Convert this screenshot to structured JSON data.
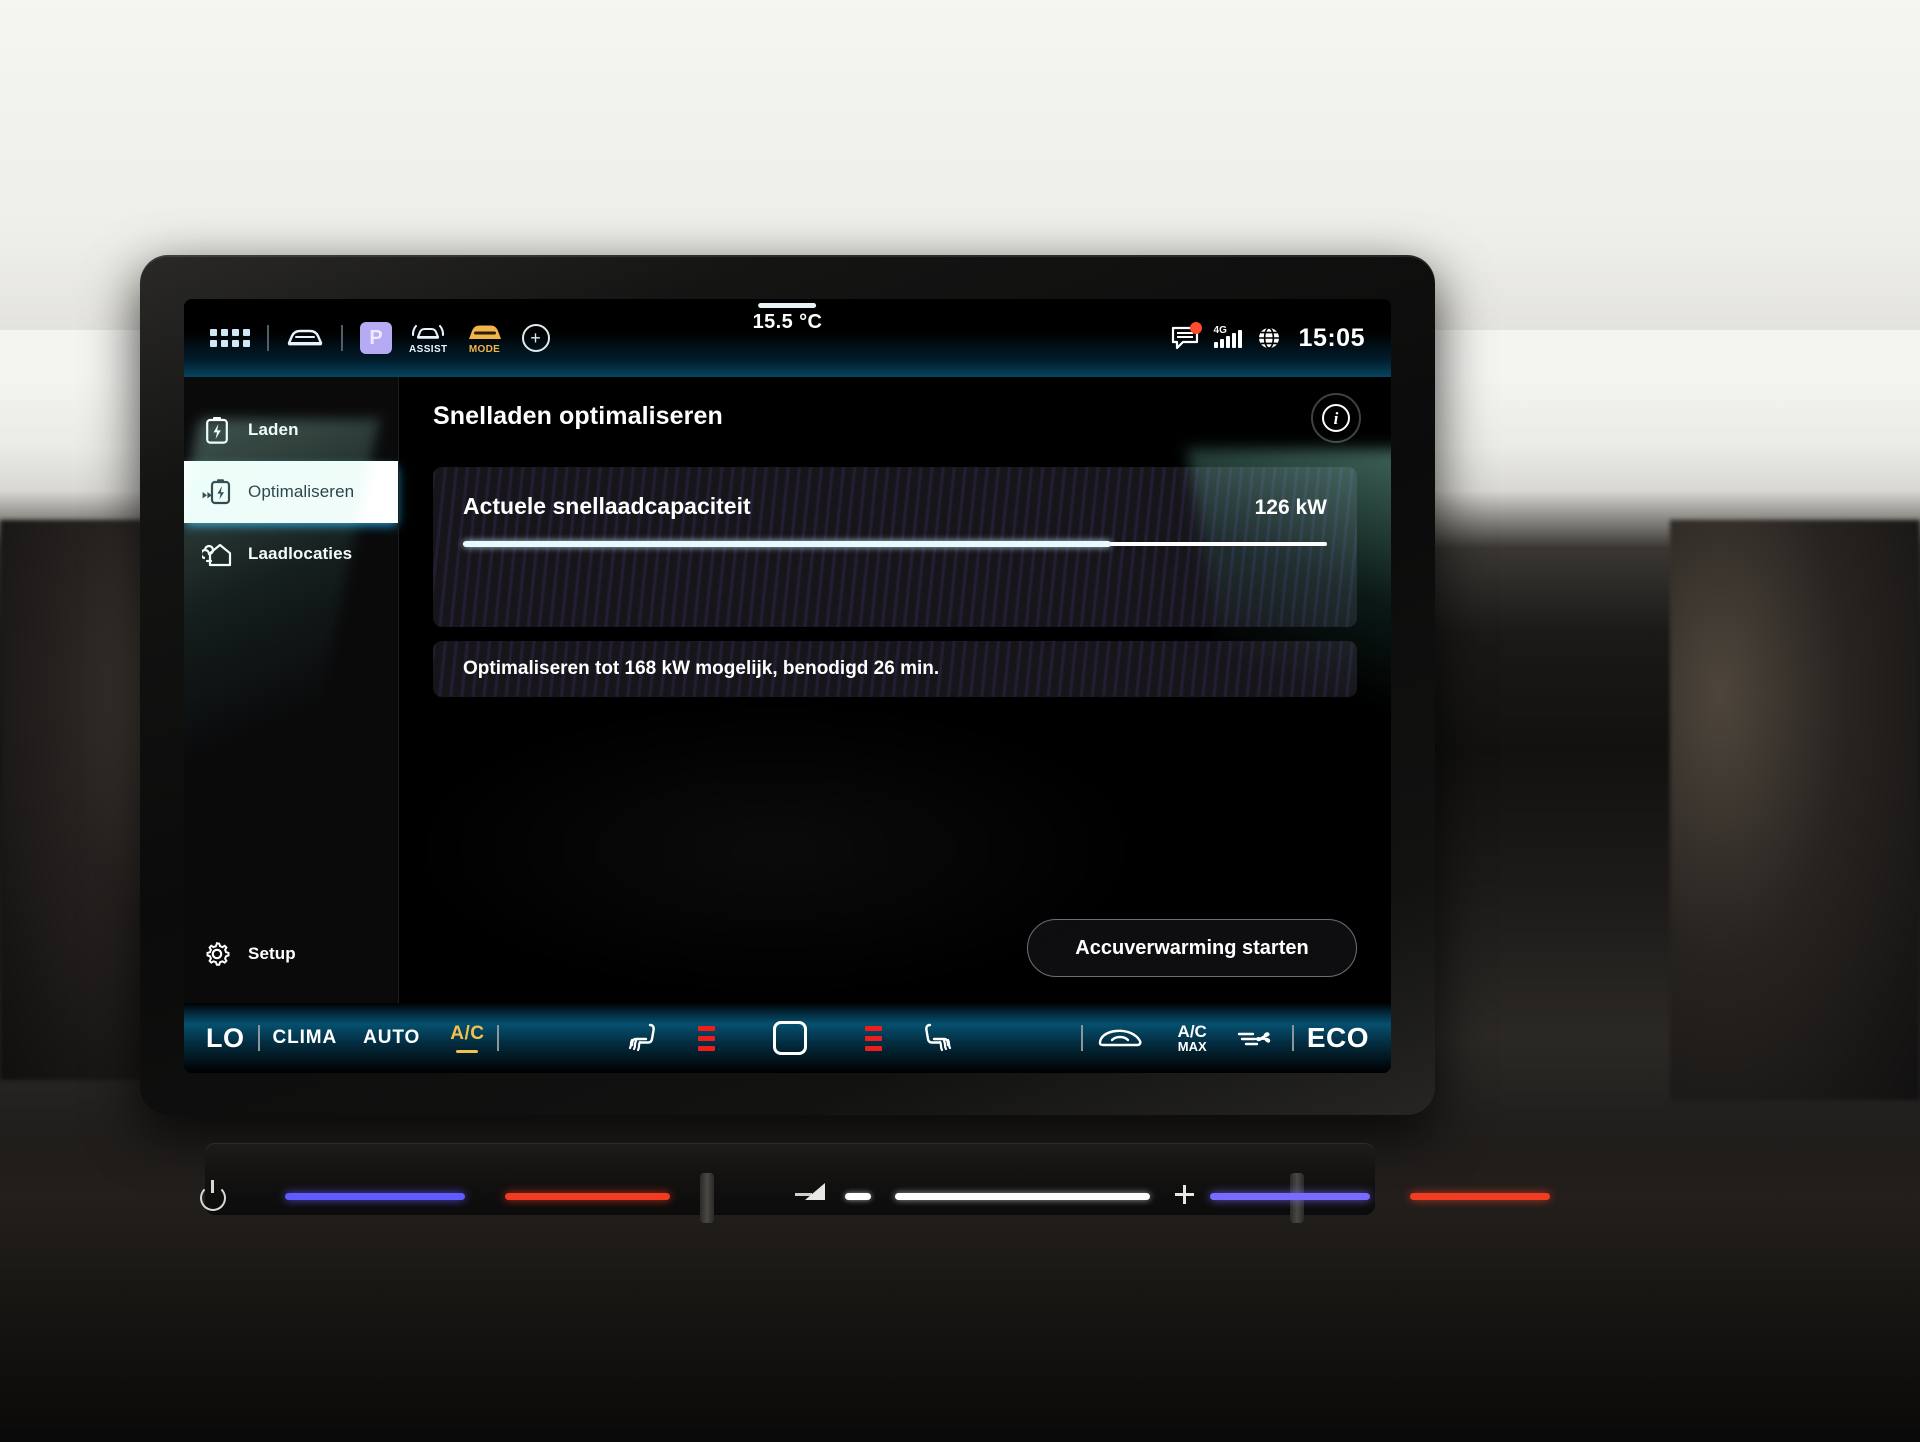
{
  "statusbar": {
    "apps_icon": "app-grid-icon",
    "car_icon": "car-front-icon",
    "park_label": "P",
    "assist_label": "ASSIST",
    "mode_label": "MODE",
    "add_label": "+",
    "temperature": "15.5 °C",
    "network_type": "4G",
    "time": "15:05",
    "message_icon": "message-icon",
    "globe_icon": "globe-icon",
    "signal_icon": "signal-bars-icon",
    "notification_dot_color": "#ff4b30"
  },
  "sidebar": {
    "items": [
      {
        "label": "Laden",
        "icon": "battery-charge-icon",
        "active": false
      },
      {
        "label": "Optimaliseren",
        "icon": "battery-boost-icon",
        "active": true
      },
      {
        "label": "Laadlocaties",
        "icon": "charge-station-icon",
        "active": false
      }
    ],
    "setup": {
      "label": "Setup",
      "icon": "gear-icon"
    }
  },
  "main": {
    "title": "Snelladen optimaliseren",
    "info_button": "info-icon",
    "capacity_card": {
      "label": "Actuele snellaadcapaciteit",
      "value": "126 kW",
      "progress_percent": 75,
      "current_kw": 126,
      "max_kw": 168
    },
    "note": "Optimaliseren tot 168 kW mogelijk, benodigd 26 min.",
    "action_button": "Accuverwarming starten"
  },
  "climate": {
    "lo": "LO",
    "clima": "CLIMA",
    "auto": "AUTO",
    "ac": "A/C",
    "ac_max_top": "A/C",
    "ac_max_bottom": "MAX",
    "eco": "ECO",
    "seat_heat_left_icon": "seat-heating-left-icon",
    "seat_heat_right_icon": "seat-heating-right-icon",
    "home_icon": "home-square-icon",
    "recirculation_icon": "air-recirculation-icon",
    "blower_icon": "blower-fan-icon",
    "level_bars_color": "#ee1e1e",
    "accent_color": "#f2c14e"
  },
  "hardware_strip": {
    "power_icon": "power-icon",
    "volume_down": "−",
    "volume_up": "+",
    "speaker_icon": "speaker-icon"
  }
}
